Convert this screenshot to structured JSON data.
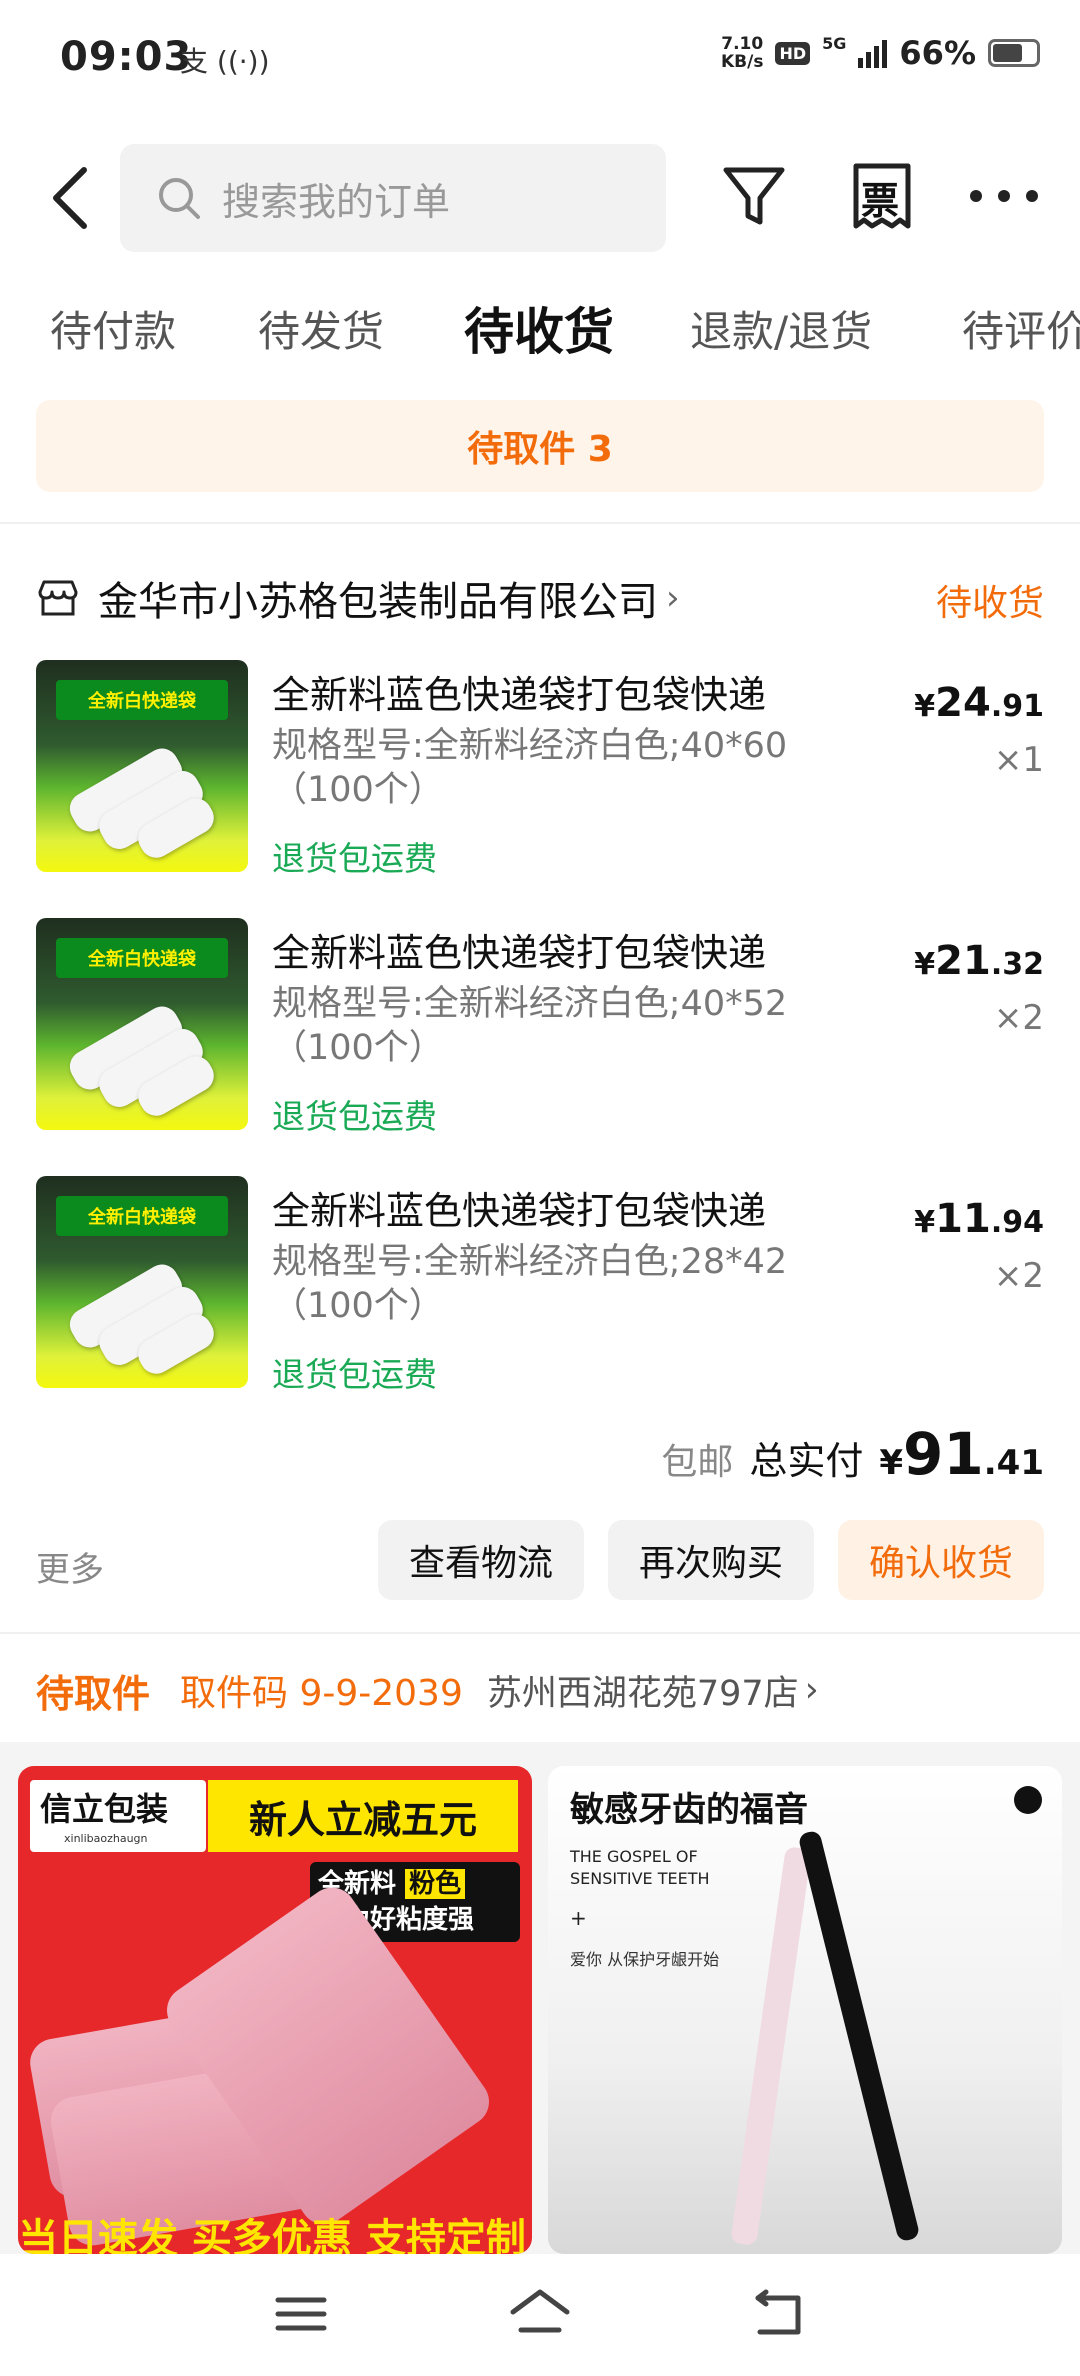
{
  "status_bar": {
    "time": "09:03",
    "left_icons": "支 ((·))",
    "speed_value": "7.10",
    "speed_unit": "KB/s",
    "hd": "HD",
    "network": "5G",
    "battery": "66%"
  },
  "header": {
    "search_placeholder": "搜索我的订单",
    "icons": [
      "back-arrow-icon",
      "search-icon",
      "filter-icon",
      "invoice-icon",
      "more-icon"
    ],
    "invoice_glyph": "票"
  },
  "tabs": [
    "待付款",
    "待发货",
    "待收货",
    "退款/退货",
    "待评价"
  ],
  "active_tab": "待收货",
  "pickup_banner": "待取件 3",
  "order": {
    "shop_name": "金华市小苏格包装制品有限公司",
    "shop_chevron": "›",
    "status": "待收货",
    "items": [
      {
        "title": "全新料蓝色快递袋打包袋快递",
        "spec": "规格型号:全新料经济白色;40*60（100个）",
        "tag": "退货包运费",
        "price_symbol": "¥",
        "price_int": "24",
        "price_dec": ".91",
        "qty": "×1",
        "thumb_caption": "全新白快递袋"
      },
      {
        "title": "全新料蓝色快递袋打包袋快递",
        "spec": "规格型号:全新料经济白色;40*52（100个）",
        "tag": "退货包运费",
        "price_symbol": "¥",
        "price_int": "21",
        "price_dec": ".32",
        "qty": "×2",
        "thumb_caption": "全新白快递袋"
      },
      {
        "title": "全新料蓝色快递袋打包袋快递",
        "spec": "规格型号:全新料经济白色;28*42（100个）",
        "tag": "退货包运费",
        "price_symbol": "¥",
        "price_int": "11",
        "price_dec": ".94",
        "qty": "×2",
        "thumb_caption": "全新白快递袋"
      }
    ],
    "free_shipping": "包邮",
    "total_label": "总实付",
    "total_symbol": "¥",
    "total_int": "91",
    "total_dec": ".41"
  },
  "actions": {
    "more": "更多",
    "view_logistics": "查看物流",
    "buy_again": "再次购买",
    "confirm_receipt": "确认收货"
  },
  "pickup_info": {
    "status": "待取件",
    "code": "取件码 9-9-2039",
    "store": "苏州西湖花苑797店",
    "chevron": "›"
  },
  "recommendations": {
    "left": {
      "brand": "信立包装",
      "brand_sub": "xinlibaozhaugn",
      "promo": "新人立减五元",
      "features_line1_a": "全新料",
      "features_line1_b": "粉色",
      "features_line2": "拉力好粘度强",
      "bottom": "当日速发 买多优惠 支持定制"
    },
    "right": {
      "title": "敏感牙齿的福音",
      "en": "THE GOSPEL OF SENSITIVE TEETH",
      "plus": "+",
      "sub": "爱你 从保护牙龈开始"
    }
  },
  "nav_bar": [
    "menu-icon",
    "home-icon",
    "back-icon"
  ]
}
